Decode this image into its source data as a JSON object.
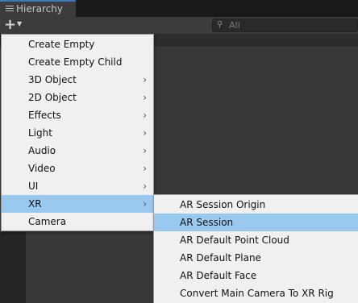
{
  "window": {
    "tab_title": "Hierarchy",
    "tab_icon": "hierarchy-list-icon"
  },
  "toolbar": {
    "add_icon": "plus-icon",
    "dropdown_icon": "caret-down-icon"
  },
  "search": {
    "placeholder": "All",
    "icon": "search-icon"
  },
  "colors": {
    "highlight": "#99c9ef",
    "menu_bg": "#f0f0f0",
    "tab_accent": "#3a79bb"
  },
  "create_menu": {
    "items": [
      {
        "label": "Create Empty",
        "submenu": false
      },
      {
        "label": "Create Empty Child",
        "submenu": false
      },
      {
        "label": "3D Object",
        "submenu": true
      },
      {
        "label": "2D Object",
        "submenu": true
      },
      {
        "label": "Effects",
        "submenu": true
      },
      {
        "label": "Light",
        "submenu": true
      },
      {
        "label": "Audio",
        "submenu": true
      },
      {
        "label": "Video",
        "submenu": true
      },
      {
        "label": "UI",
        "submenu": true
      },
      {
        "label": "XR",
        "submenu": true,
        "highlighted": true
      },
      {
        "label": "Camera",
        "submenu": false
      }
    ]
  },
  "xr_submenu": {
    "items": [
      {
        "label": "AR Session Origin"
      },
      {
        "label": "AR Session",
        "highlighted": true
      },
      {
        "label": "AR Default Point Cloud"
      },
      {
        "label": "AR Default Plane"
      },
      {
        "label": "AR Default Face"
      },
      {
        "label": "Convert Main Camera To XR Rig"
      }
    ]
  },
  "arrow_glyph": "›"
}
